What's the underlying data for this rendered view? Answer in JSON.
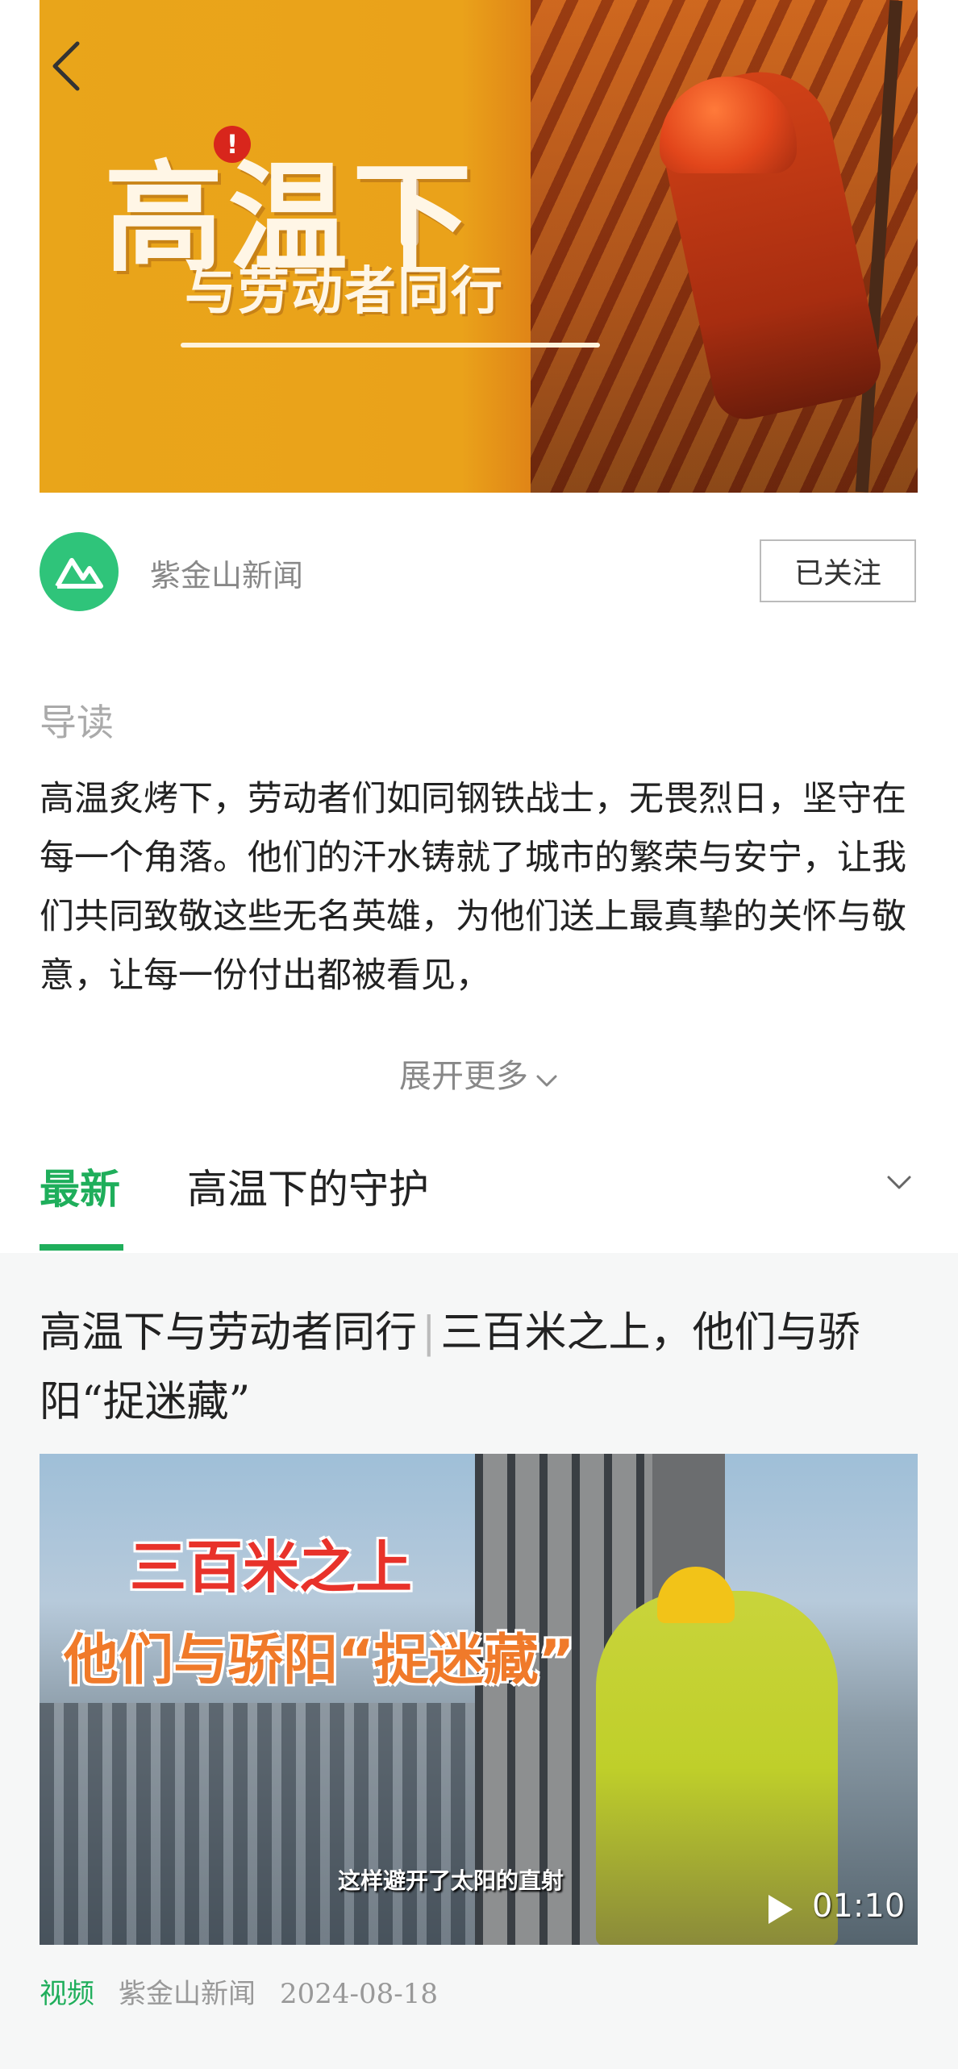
{
  "banner": {
    "title_main": "高温下",
    "title_sub": "与劳动者同行",
    "alert_symbol": "!"
  },
  "author": {
    "name": "紫金山新闻",
    "follow_label": "已关注",
    "avatar_color": "#2fc47a"
  },
  "intro": {
    "heading": "导读",
    "body": "高温炙烤下，劳动者们如同钢铁战士，无畏烈日，坚守在每一个角落。他们的汗水铸就了城市的繁荣与安宁，让我们共同致敬这些无名英雄，为他们送上最真挚的关怀与敬意，让每一份付出都被看见，",
    "expand_label": "展开更多"
  },
  "tabs": {
    "items": [
      {
        "label": "最新",
        "active": true
      },
      {
        "label": "高温下的守护",
        "active": false
      }
    ],
    "accent_color": "#1fae5b"
  },
  "article": {
    "title_part1": "高温下与劳动者同行",
    "title_sep": "|",
    "title_part2": "三百米之上，他们与骄阳“捉迷藏”",
    "video": {
      "overlay_line1": "三百米之上",
      "overlay_line2": "他们与骄阳“捉迷藏”",
      "subtitle": "这样避开了太阳的直射",
      "duration": "01:10"
    },
    "meta": {
      "tag": "视频",
      "source": "紫金山新闻",
      "date": "2024-08-18"
    }
  }
}
